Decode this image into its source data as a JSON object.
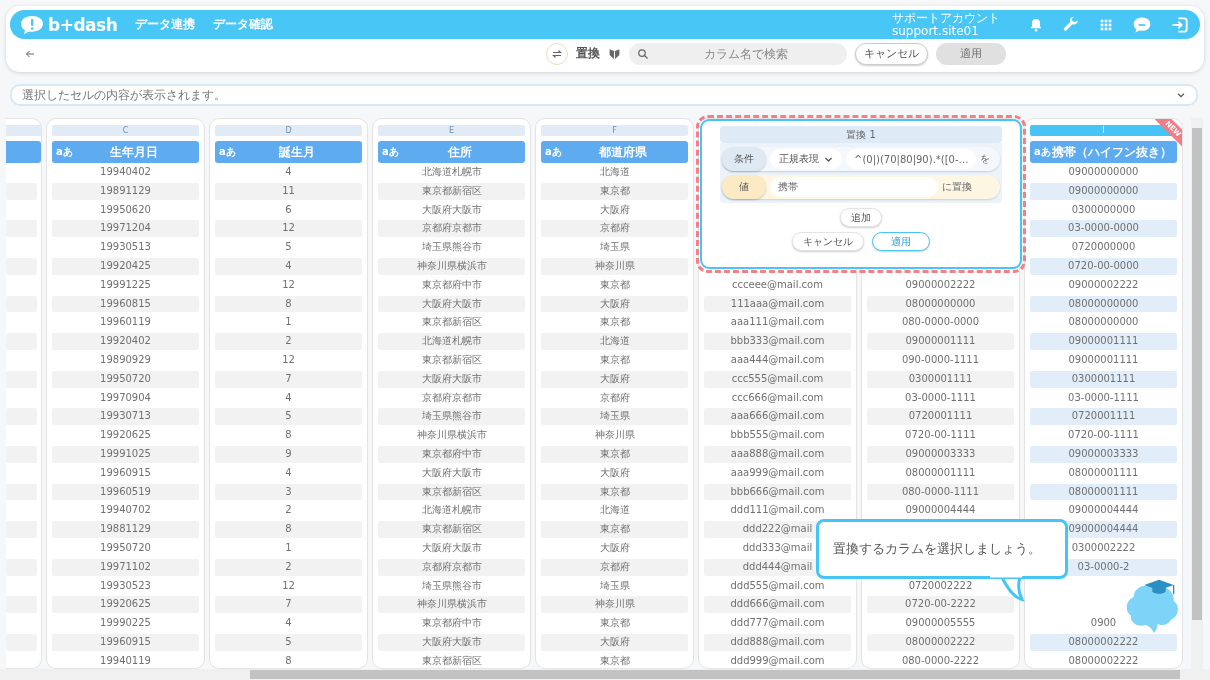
{
  "header": {
    "logo": "b+dash",
    "nav": [
      "データ連携",
      "データ確認"
    ],
    "account": {
      "name": "サポートアカウント",
      "id": "support.site01"
    }
  },
  "toolbar": {
    "label": "置換",
    "search": {
      "placeholder": "カラム名で検索"
    },
    "cancel": "キャンセル",
    "apply": {
      "label": "適用",
      "disabled": true
    }
  },
  "cell_viewer": {
    "placeholder": "選択したセルの内容が表示されます。"
  },
  "columns": [
    {
      "letter": "C",
      "type_label": "aあ",
      "title": "生年月日",
      "selected": false,
      "cells": [
        "19940402",
        "19891129",
        "19950620",
        "19971204",
        "19930513",
        "19920425",
        "19991225",
        "19960815",
        "19960119",
        "19920402",
        "19890929",
        "19950720",
        "19970904",
        "19930713",
        "19920625",
        "19991025",
        "19960915",
        "19960519",
        "19940702",
        "19881129",
        "19950720",
        "19971102",
        "19930523",
        "19920625",
        "19990225",
        "19960915",
        "19940119"
      ]
    },
    {
      "letter": "D",
      "type_label": "aあ",
      "title": "誕生月",
      "selected": false,
      "cells": [
        "4",
        "11",
        "6",
        "12",
        "5",
        "4",
        "12",
        "8",
        "1",
        "2",
        "12",
        "7",
        "4",
        "5",
        "8",
        "9",
        "4",
        "3",
        "2",
        "8",
        "1",
        "2",
        "12",
        "7",
        "4",
        "5",
        "8"
      ]
    },
    {
      "letter": "E",
      "type_label": "aあ",
      "title": "住所",
      "selected": false,
      "cells": [
        "北海道札幌市",
        "東京都新宿区",
        "大阪府大阪市",
        "京都府京都市",
        "埼玉県熊谷市",
        "神奈川県横浜市",
        "東京都府中市",
        "大阪府大阪市",
        "東京都新宿区",
        "北海道札幌市",
        "東京都新宿区",
        "大阪府大阪市",
        "京都府京都市",
        "埼玉県熊谷市",
        "神奈川県横浜市",
        "東京都府中市",
        "大阪府大阪市",
        "東京都新宿区",
        "北海道札幌市",
        "東京都新宿区",
        "大阪府大阪市",
        "京都府京都市",
        "埼玉県熊谷市",
        "神奈川県横浜市",
        "東京都府中市",
        "大阪府大阪市",
        "東京都新宿区"
      ]
    },
    {
      "letter": "F",
      "type_label": "aあ",
      "title": "都道府県",
      "selected": false,
      "cells": [
        "北海道",
        "東京都",
        "大阪府",
        "京都府",
        "埼玉県",
        "神奈川県",
        "東京都",
        "大阪府",
        "東京都",
        "北海道",
        "東京都",
        "大阪府",
        "京都府",
        "埼玉県",
        "神奈川県",
        "東京都",
        "大阪府",
        "東京都",
        "北海道",
        "東京都",
        "大阪府",
        "京都府",
        "埼玉県",
        "神奈川県",
        "東京都",
        "大阪府",
        "東京都"
      ]
    },
    {
      "selected": false,
      "cells": [
        null,
        null,
        null,
        null,
        null,
        null,
        "ccceee@mail.com",
        "111aaa@mail.com",
        "aaa111@mail.com",
        "bbb333@mail.com",
        "aaa444@mail.com",
        "ccc555@mail.com",
        "ccc666@mail.com",
        "aaa666@mail.com",
        "bbb555@mail.com",
        "aaa888@mail.com",
        "aaa999@mail.com",
        "bbb666@mail.com",
        "ddd111@mail.com",
        "ddd222@mail",
        "ddd333@mail",
        "ddd444@mail",
        "ddd555@mail.com",
        "ddd666@mail.com",
        "ddd777@mail.com",
        "ddd888@mail.com",
        "ddd999@mail.com"
      ]
    },
    {
      "selected": false,
      "cells": [
        null,
        null,
        null,
        null,
        null,
        null,
        "09000002222",
        "08000000000",
        "080-0000-0000",
        "09000001111",
        "090-0000-1111",
        "0300001111",
        "03-0000-1111",
        "0720001111",
        "0720-00-1111",
        "09000003333",
        "08000001111",
        "080-0000-1111",
        "09000004444",
        null,
        null,
        null,
        "0720002222",
        "0720-00-2222",
        "09000005555",
        "08000002222",
        "080-0000-2222"
      ]
    },
    {
      "letter": "I",
      "type_label": "aあ",
      "title": "携帯（ハイフン抜き）",
      "selected": true,
      "badge": "NEW",
      "cells": [
        "09000000000",
        "09000000000",
        "0300000000",
        "03-0000-0000",
        "0720000000",
        "0720-00-0000",
        "09000002222",
        "08000000000",
        "08000000000",
        "09000001111",
        "09000001111",
        "0300001111",
        "03-0000-1111",
        "0720001111",
        "0720-00-1111",
        "09000003333",
        "08000001111",
        "08000001111",
        "09000004444",
        "09000004444",
        "0300002222",
        "03-0000-2",
        null,
        null,
        "0900",
        "08000002222",
        "08000002222"
      ]
    }
  ],
  "replace_popup": {
    "title": "置換 1",
    "condition": {
      "label": "条件",
      "mode": "正規表現",
      "pattern": "^(0|)(70|80|90).*([0-…",
      "suffix": "を"
    },
    "value": {
      "label": "値",
      "text": "携帯",
      "suffix": "に置換"
    },
    "add": "追加",
    "cancel": "キャンセル",
    "apply": "適用"
  },
  "hint": {
    "text": "置換するカラムを選択しましょう。"
  }
}
